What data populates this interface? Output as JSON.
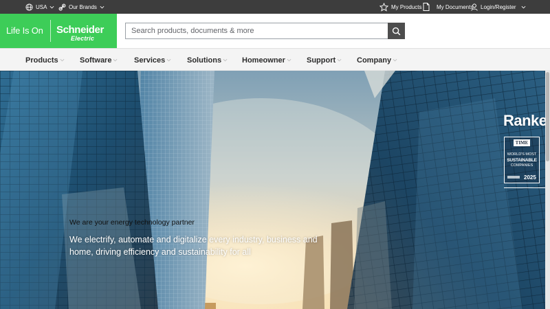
{
  "utility_bar": {
    "country": "USA",
    "brands": "Our Brands",
    "my_products": "My Products",
    "my_documents": "My Documents",
    "login": "Login/Register"
  },
  "header": {
    "tagline": "Life Is On",
    "brand_line1": "Schneider",
    "brand_line2": "Electric",
    "search_placeholder": "Search products, documents & more"
  },
  "nav": {
    "items": [
      {
        "label": "Products"
      },
      {
        "label": "Software"
      },
      {
        "label": "Services"
      },
      {
        "label": "Solutions"
      },
      {
        "label": "Homeowner"
      },
      {
        "label": "Support"
      },
      {
        "label": "Company"
      }
    ]
  },
  "hero": {
    "eyebrow": "We are your energy technology partner",
    "body": "We electrify, automate and digitalize every industry, business and home, driving efficiency and sustainability for all",
    "ranked": "Ranked",
    "badge": {
      "time": "TIME",
      "line1": "WORLD'S MOST",
      "line2": "SUSTAINABLE",
      "line3": "COMPANIES",
      "year": "2025"
    }
  },
  "colors": {
    "brand_green": "#3dcd58",
    "utility_bg": "#3d3d3d",
    "nav_bg": "#f4f4f4",
    "search_button": "#4d4d4d"
  },
  "icons": {
    "country": "globe-icon",
    "brands": "link-icon",
    "products": "star-icon",
    "documents": "document-icon",
    "login": "user-icon",
    "search": "search-icon"
  }
}
